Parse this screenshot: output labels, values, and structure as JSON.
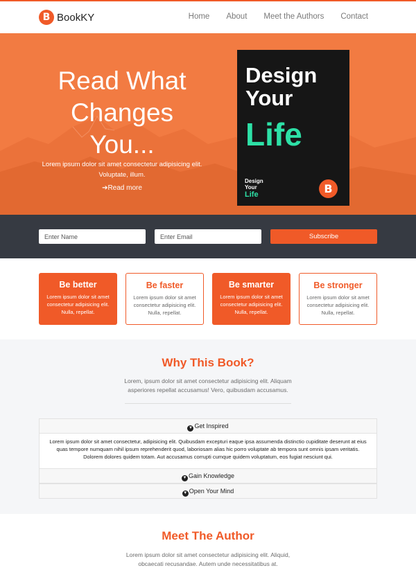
{
  "nav": {
    "brand_letter": "B",
    "brand_name": "BookKY",
    "links": [
      "Home",
      "About",
      "Meet the Authors",
      "Contact"
    ]
  },
  "hero": {
    "title_lines": [
      "Read What",
      "Changes",
      "You..."
    ],
    "text": "Lorem ipsum dolor sit amet consectetur adipisicing elit. Voluptate, illum.",
    "read_more": "Read more",
    "arrow_icon": "arrow-right-icon"
  },
  "book": {
    "title_line1": "Design",
    "title_line2": "Your",
    "title_line3": "Life",
    "small_line1": "Design",
    "small_line2": "Your",
    "small_line3": "Life",
    "logo_letter": "B",
    "accent_color": "#2de0a6"
  },
  "subscribe": {
    "name_placeholder": "Enter Name",
    "email_placeholder": "Enter Email",
    "button_label": "Subscribe"
  },
  "features": [
    {
      "title": "Be better",
      "text": "Lorem ipsum dolor sit amet consectetur adipisicing elit. Nulla, repellat.",
      "style": "filled"
    },
    {
      "title": "Be faster",
      "text": "Lorem ipsum dolor sit amet consectetur adipisicing elit. Nulla, repellat.",
      "style": "outlined"
    },
    {
      "title": "Be smarter",
      "text": "Lorem ipsum dolor sit amet consectetur adipisicing elit. Nulla, repellat.",
      "style": "filled"
    },
    {
      "title": "Be stronger",
      "text": "Lorem ipsum dolor sit amet consectetur adipisicing elit. Nulla, repellat.",
      "style": "outlined"
    }
  ],
  "why": {
    "title": "Why This Book?",
    "text": "Lorem, ipsum dolor sit amet consectetur adipisicing elit. Aliquam asperiores repellat accusamus! Vero, quibusdam accusamus.",
    "accordion": [
      {
        "label": "Get Inspired",
        "expanded": true,
        "body": "Lorem ipsum dolor sit amet consectetur, adipisicing elit. Quibusdam excepturi eaque ipsa assumenda distinctio cupiditate deserunt at eius quas tempore numquam nihil ipsum reprehenderit quod, laboriosam alias hic porro voluptate ab tempora sunt omnis ipsam veritatis. Dolorem dolores quidem totam. Aut accusamus corrupti cumque quidem voluptatum, eos fugiat nesciunt qui."
      },
      {
        "label": "Gain Knowledge",
        "expanded": false
      },
      {
        "label": "Open Your Mind",
        "expanded": false
      }
    ]
  },
  "meet": {
    "title": "Meet The Author",
    "text": "Lorem ipsum dolor sit amet consectetur adipisicing elit. Aliquid, obcaecati recusandae. Autem unde necessitatibus at."
  },
  "colors": {
    "brand": "#f05a28",
    "hero_bg": "#f27b42",
    "dark_bar": "#363a42"
  }
}
